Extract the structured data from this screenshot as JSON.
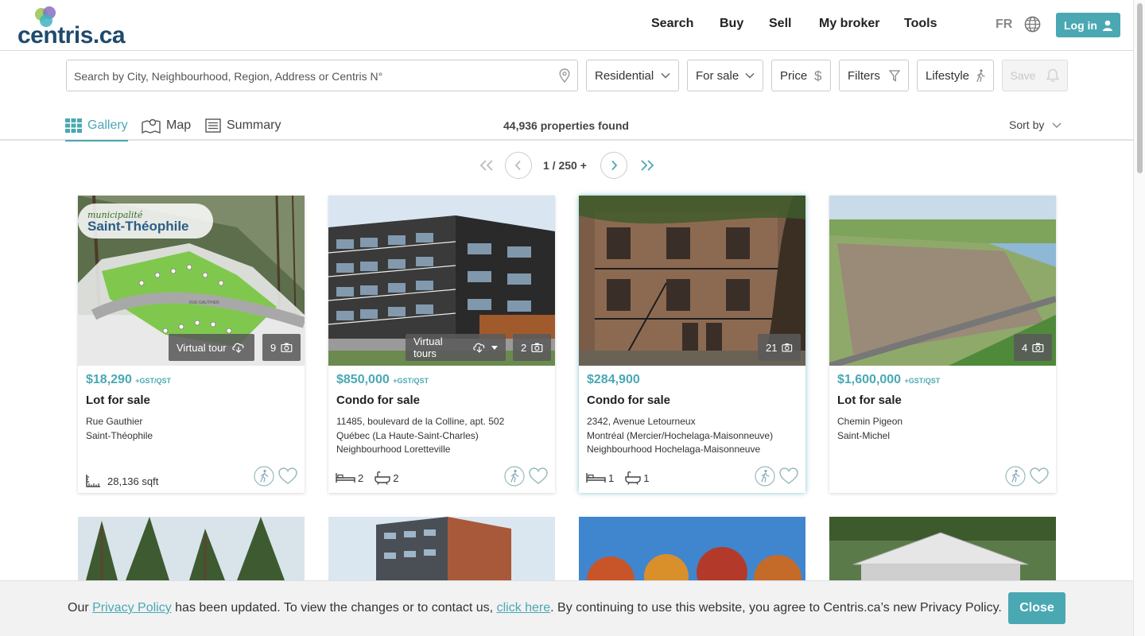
{
  "header": {
    "logo": "centris.ca",
    "nav": [
      "Search",
      "Buy",
      "Sell",
      "My broker",
      "Tools"
    ],
    "lang": "FR",
    "login_label": "Log in"
  },
  "search": {
    "placeholder": "Search by City, Neighbourhood, Region, Address or Centris N°",
    "filters": {
      "category": "Residential",
      "transaction": "For sale",
      "price": "Price",
      "filters": "Filters",
      "lifestyle": "Lifestyle",
      "save": "Save"
    }
  },
  "views": {
    "gallery": "Gallery",
    "map": "Map",
    "summary": "Summary",
    "count": "44,936 properties found",
    "sort_label": "Sort by"
  },
  "pagination": {
    "text": "1 / 250 +"
  },
  "listings": [
    {
      "price": "$18,290",
      "tax": "+GST/QST",
      "type": "Lot for sale",
      "address": [
        "Rue Gauthier",
        "Saint-Théophile"
      ],
      "virtual_tour": "Virtual tour",
      "photos": "9",
      "area": "28,136 sqft",
      "photo_logo_top": "municipalité",
      "photo_logo_main": "Saint-Théophile",
      "photo_street": "RUE GAUTHIER"
    },
    {
      "price": "$850,000",
      "tax": "+GST/QST",
      "type": "Condo for sale",
      "address": [
        "11485, boulevard de la Colline, apt. 502",
        "Québec (La Haute-Saint-Charles)",
        "Neighbourhood Loretteville"
      ],
      "virtual_tour": "Virtual tours",
      "photos": "2",
      "beds": "2",
      "baths": "2"
    },
    {
      "price": "$284,900",
      "tax": "",
      "type": "Condo for sale",
      "address": [
        "2342, Avenue Letourneux",
        "Montréal (Mercier/Hochelaga-Maisonneuve)",
        "Neighbourhood Hochelaga-Maisonneuve"
      ],
      "photos": "21",
      "beds": "1",
      "baths": "1"
    },
    {
      "price": "$1,600,000",
      "tax": "+GST/QST",
      "type": "Lot for sale",
      "address": [
        "Chemin Pigeon",
        "Saint-Michel"
      ],
      "photos": "4"
    }
  ],
  "privacy": {
    "text_1": "Our ",
    "link_1": "Privacy Policy",
    "text_2": " has been updated. To view the changes or to contact us, ",
    "link_2": "click here",
    "text_3": ". By continuing to use this website, you agree to Centris.ca’s new Privacy Policy.",
    "close_label": "Close"
  },
  "colors": {
    "accent": "#4aa8b3",
    "brand": "#1e4a6d"
  }
}
